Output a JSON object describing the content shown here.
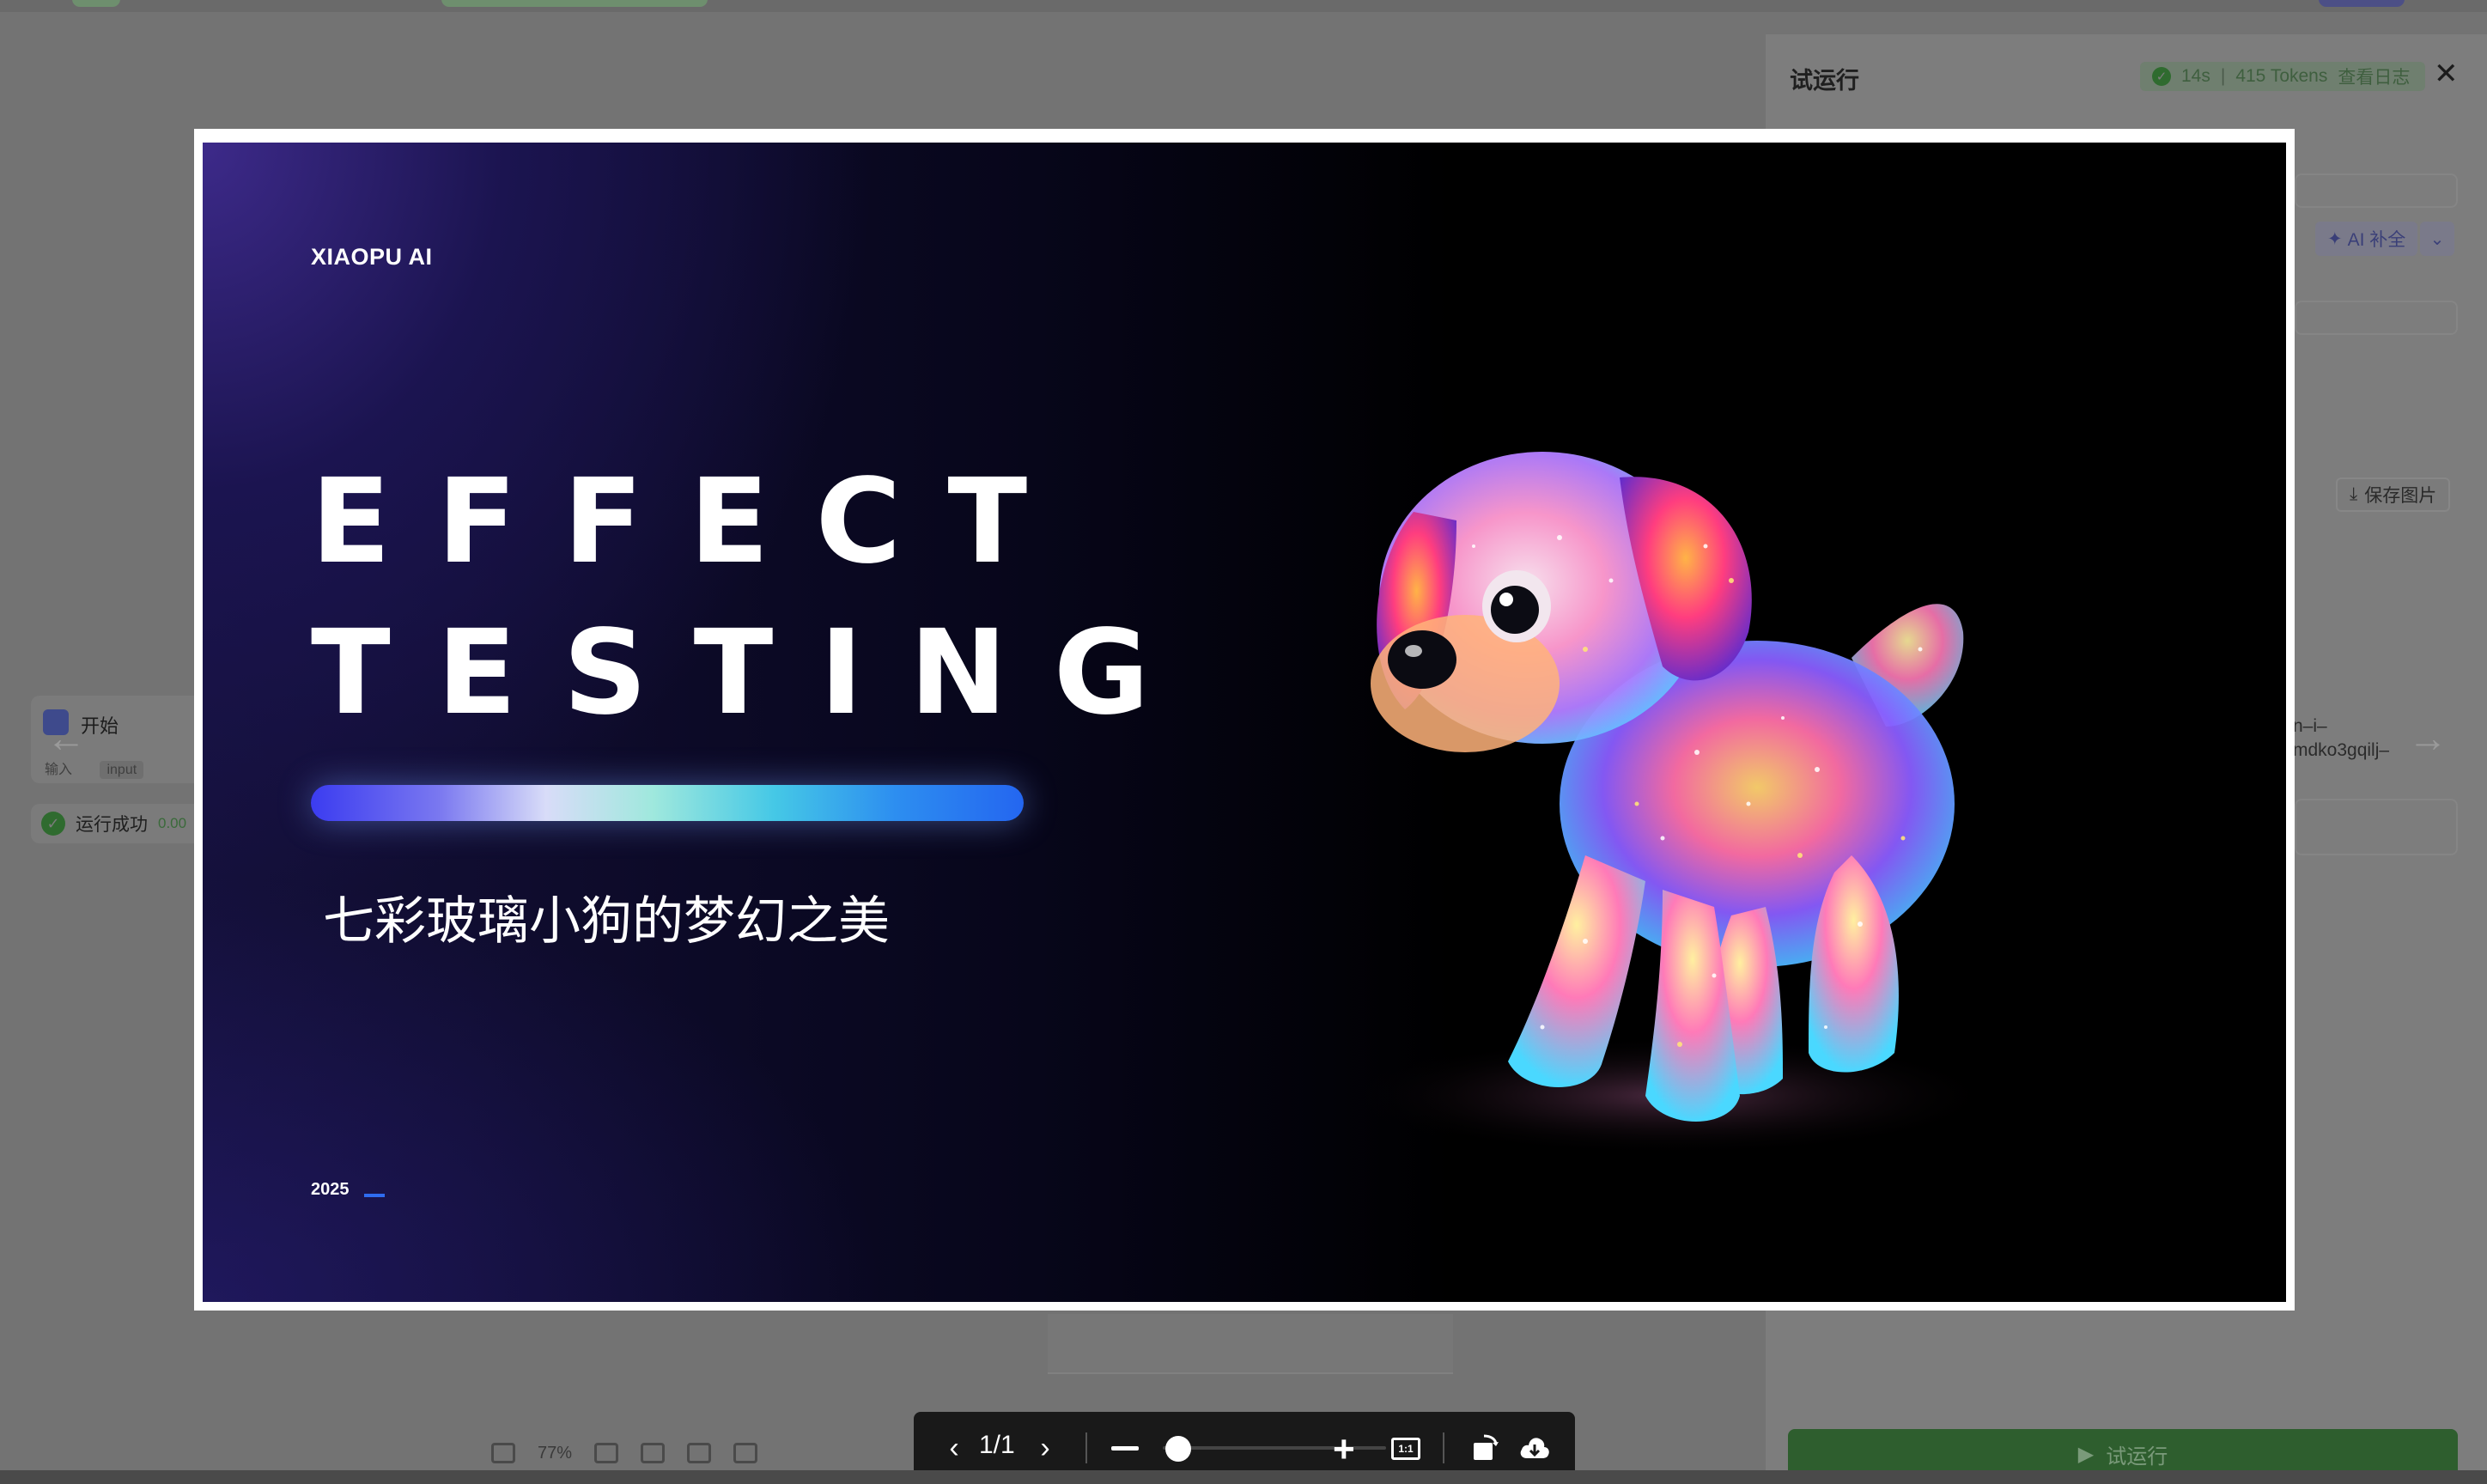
{
  "side_panel": {
    "title": "试运行",
    "status": {
      "duration": "14s",
      "tokens": "415 Tokens",
      "log_link": "查看日志"
    },
    "ai_button_label": "AI 补全",
    "save_image_label": "保存图片",
    "hash_text_line1": "n–i–",
    "hash_text_line2": "mdko3gqilj–",
    "run_button_label": "试运行"
  },
  "canvas": {
    "node_title": "开始",
    "node_input_label": "输入",
    "node_input_tag": "input",
    "run_status_label": "运行成功",
    "run_status_value": "0.00",
    "zoom_level": "77%"
  },
  "preview": {
    "brand": "XIAOPU AI",
    "headline_line1": "EFFECT",
    "headline_line2": "TESTING",
    "subtitle": "七彩玻璃小狗的梦幻之美",
    "year": "2025"
  },
  "viewer": {
    "page_indicator": "1/1",
    "fit_label": "1:1",
    "zoom_fraction": 0.1
  },
  "colors": {
    "accent_bar_start": "#3b3cf0",
    "accent_bar_end": "#2466f0",
    "success_green": "#2f6b2f"
  }
}
